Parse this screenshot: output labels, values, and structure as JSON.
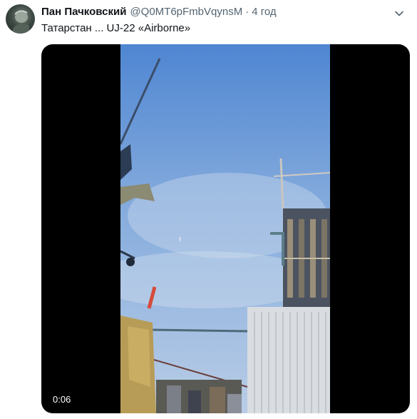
{
  "tweet": {
    "author_name": "Пан Пачковский",
    "author_handle": "@Q0MT6pFmbVqynsM",
    "separator": "·",
    "time_ago": "4 год",
    "text": "Татарстан ...  UJ-22 «Airborne»",
    "more_icon": "chevron-down-icon",
    "avatar_icon": "avatar"
  },
  "video": {
    "duration": "0:06"
  },
  "colors": {
    "secondary_text": "#536471",
    "primary_text": "#0f1419",
    "sky": "#7fa7dc"
  }
}
